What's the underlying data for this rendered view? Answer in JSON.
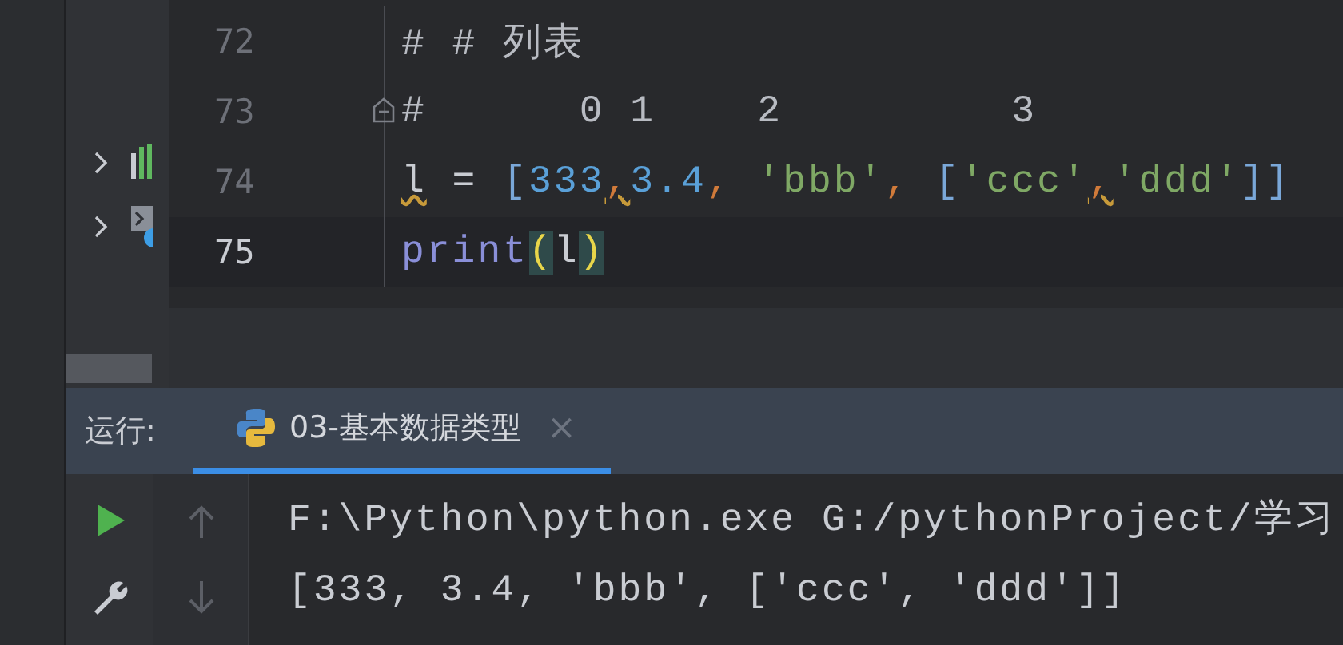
{
  "editor": {
    "lines": [
      {
        "number": "72",
        "current": false,
        "fold": false,
        "tokens": [
          {
            "text": "# # 列表",
            "kind": "comment"
          }
        ]
      },
      {
        "number": "73",
        "current": false,
        "fold": true,
        "tokens": [
          {
            "text": "#      0 1    2         3",
            "kind": "comment"
          }
        ]
      },
      {
        "number": "74",
        "current": false,
        "fold": false,
        "tokens": [
          {
            "text": "l",
            "kind": "warn"
          },
          {
            "text": " = ",
            "kind": "plain"
          },
          {
            "text": "[",
            "kind": "bracket"
          },
          {
            "text": "333",
            "kind": "number"
          },
          {
            "text": ",",
            "kind": "warn-punct"
          },
          {
            "text": "3.4",
            "kind": "number"
          },
          {
            "text": ",",
            "kind": "punct"
          },
          {
            "text": " 'bbb'",
            "kind": "string"
          },
          {
            "text": ",",
            "kind": "punct"
          },
          {
            "text": " [",
            "kind": "bracket"
          },
          {
            "text": "'ccc'",
            "kind": "string"
          },
          {
            "text": ",",
            "kind": "warn-punct"
          },
          {
            "text": "'ddd'",
            "kind": "string"
          },
          {
            "text": "]]",
            "kind": "bracket"
          }
        ]
      },
      {
        "number": "75",
        "current": true,
        "fold": false,
        "tokens": [
          {
            "text": "print",
            "kind": "func"
          },
          {
            "text": "(",
            "kind": "paren-match"
          },
          {
            "text": "l",
            "kind": "plain"
          },
          {
            "text": ")",
            "kind": "paren-match"
          }
        ]
      }
    ]
  },
  "run_panel": {
    "label": "运行:",
    "tabs": [
      {
        "label": "03-基本数据类型",
        "selected": true,
        "close": "×"
      }
    ],
    "output": [
      "F:\\Python\\python.exe G:/pythonProject/学习",
      "[333, 3.4, 'bbb', ['ccc', 'ddd']]"
    ]
  }
}
